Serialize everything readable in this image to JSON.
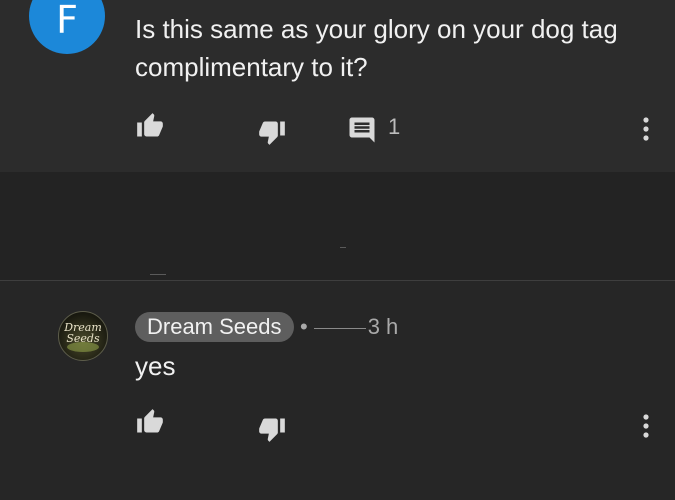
{
  "top_comment": {
    "avatar_letter": "F",
    "text": "Is this same as your glory on your dog tag complimentary to it?",
    "reply_count": "1"
  },
  "reply_comment": {
    "author": "Dream Seeds",
    "separator": "•",
    "time": "3 h",
    "text": "yes"
  },
  "colors": {
    "avatar_blue": "#1c88d9",
    "badge_gray": "#5e5e5e",
    "icon_gray": "#d9d9d9"
  },
  "icons": [
    "like-icon",
    "dislike-icon",
    "reply-icon",
    "more-options-icon"
  ]
}
